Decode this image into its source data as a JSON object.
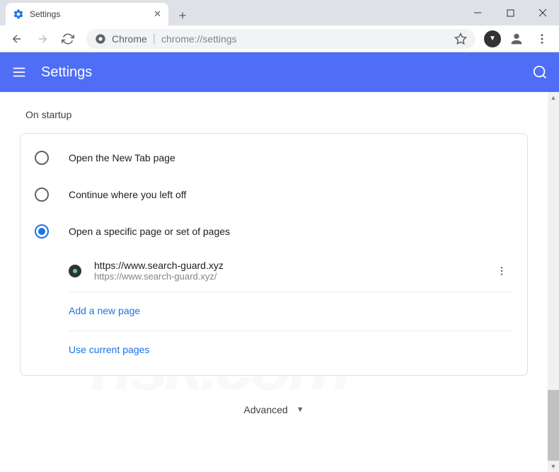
{
  "window": {
    "tab_title": "Settings",
    "addr_scheme_label": "Chrome",
    "addr_url": "chrome://settings"
  },
  "header": {
    "title": "Settings"
  },
  "startup": {
    "section_title": "On startup",
    "options": [
      {
        "label": "Open the New Tab page"
      },
      {
        "label": "Continue where you left off"
      },
      {
        "label": "Open a specific page or set of pages"
      }
    ],
    "page": {
      "display": "https://www.search-guard.xyz",
      "url": "https://www.search-guard.xyz/"
    },
    "add_page_label": "Add a new page",
    "use_current_label": "Use current pages"
  },
  "advanced_label": "Advanced"
}
